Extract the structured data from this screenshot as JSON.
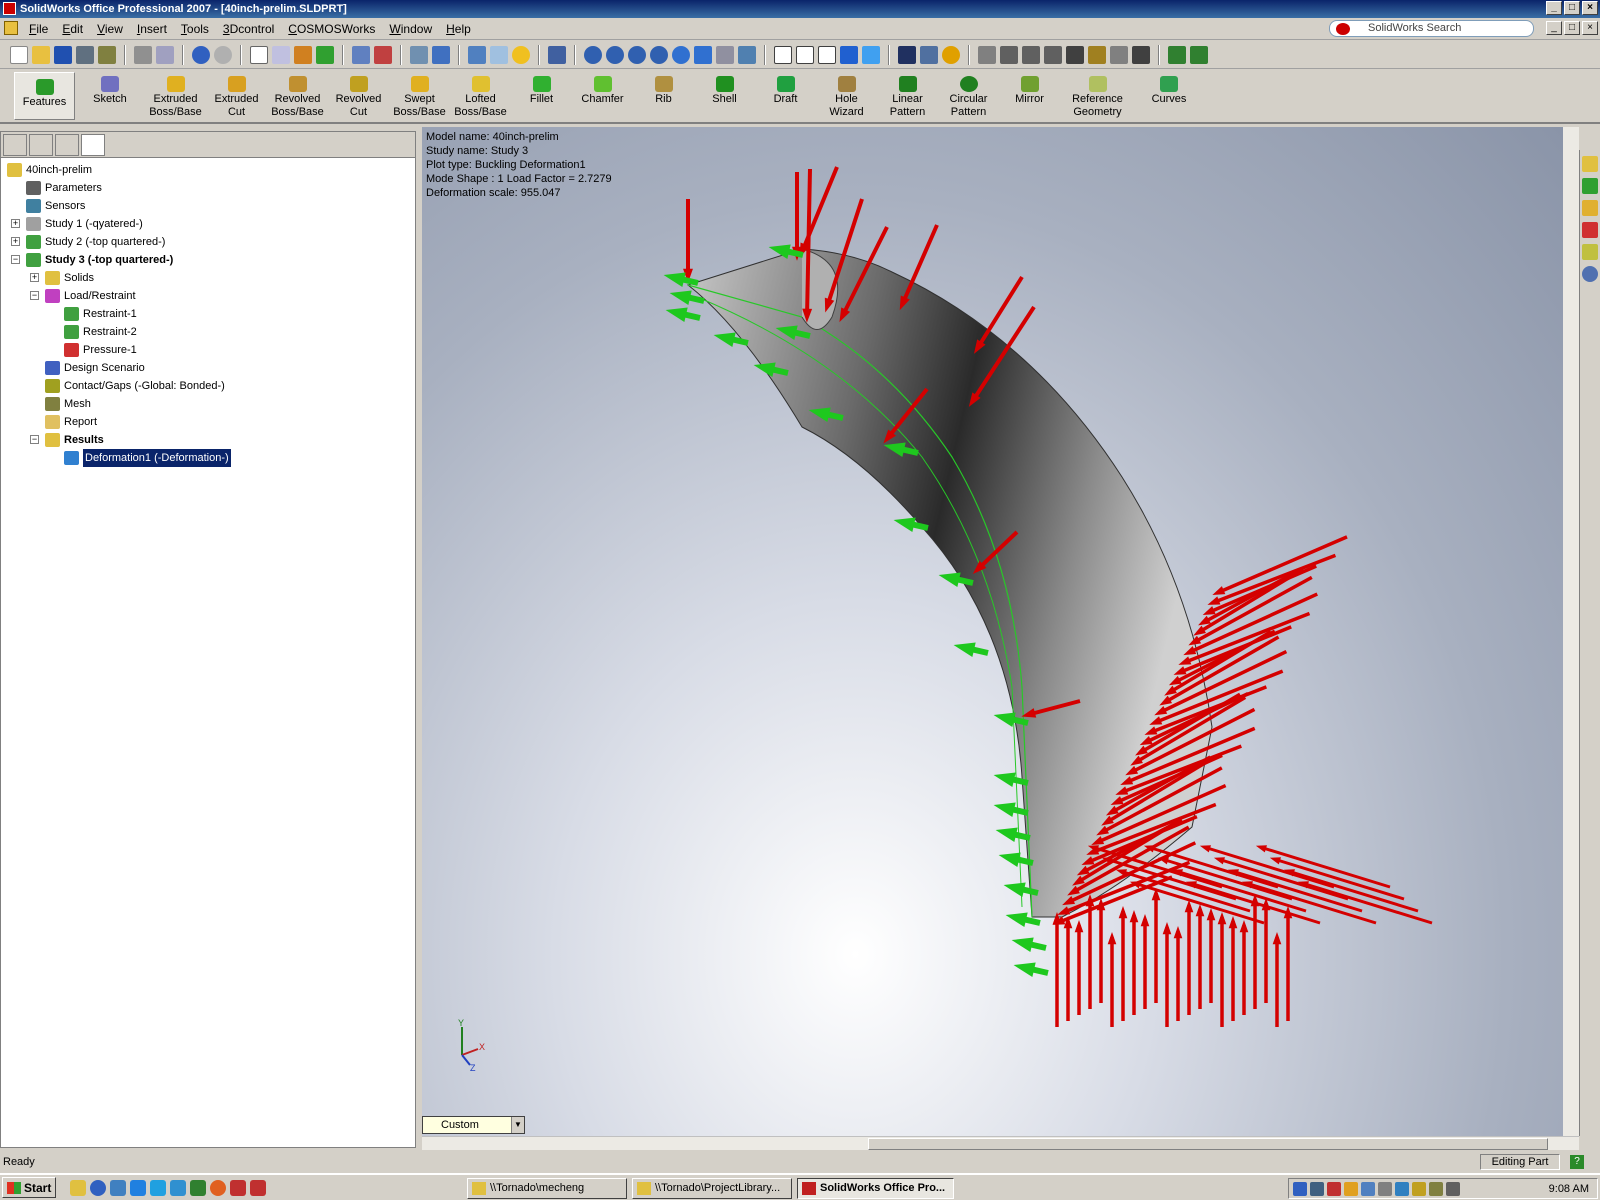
{
  "window": {
    "title": "SolidWorks Office Professional 2007 - [40inch-prelim.SLDPRT]",
    "controls": [
      "_",
      "□",
      "×"
    ]
  },
  "menu": [
    "File",
    "Edit",
    "View",
    "Insert",
    "Tools",
    "3Dcontrol",
    "COSMOSWorks",
    "Window",
    "Help"
  ],
  "search": {
    "placeholder": "SolidWorks Search"
  },
  "command_manager": [
    {
      "label": "Features",
      "icon": "features-icon"
    },
    {
      "label": "Sketch",
      "icon": "sketch-icon"
    },
    {
      "label": "Extruded\nBoss/Base",
      "icon": "extruded-boss-icon"
    },
    {
      "label": "Extruded\nCut",
      "icon": "extruded-cut-icon"
    },
    {
      "label": "Revolved\nBoss/Base",
      "icon": "revolved-boss-icon"
    },
    {
      "label": "Revolved\nCut",
      "icon": "revolved-cut-icon"
    },
    {
      "label": "Swept\nBoss/Base",
      "icon": "swept-boss-icon"
    },
    {
      "label": "Lofted\nBoss/Base",
      "icon": "lofted-boss-icon"
    },
    {
      "label": "Fillet",
      "icon": "fillet-icon"
    },
    {
      "label": "Chamfer",
      "icon": "chamfer-icon"
    },
    {
      "label": "Rib",
      "icon": "rib-icon"
    },
    {
      "label": "Shell",
      "icon": "shell-icon"
    },
    {
      "label": "Draft",
      "icon": "draft-icon"
    },
    {
      "label": "Hole\nWizard",
      "icon": "hole-wizard-icon"
    },
    {
      "label": "Linear\nPattern",
      "icon": "linear-pattern-icon"
    },
    {
      "label": "Circular\nPattern",
      "icon": "circular-pattern-icon"
    },
    {
      "label": "Mirror",
      "icon": "mirror-icon"
    },
    {
      "label": "Reference\nGeometry",
      "icon": "reference-geometry-icon"
    },
    {
      "label": "Curves",
      "icon": "curves-icon"
    }
  ],
  "tree": {
    "root": "40inch-prelim",
    "parameters": "Parameters",
    "sensors": "Sensors",
    "study1": "Study 1 (-qyatered-)",
    "study2": "Study 2 (-top quartered-)",
    "study3": "Study 3 (-top quartered-)",
    "solids": "Solids",
    "load_restraint": "Load/Restraint",
    "restraint1": "Restraint-1",
    "restraint2": "Restraint-2",
    "pressure1": "Pressure-1",
    "design_scenario": "Design Scenario",
    "contact": "Contact/Gaps (-Global: Bonded-)",
    "mesh": "Mesh",
    "report": "Report",
    "results": "Results",
    "deformation": "Deformation1 (-Deformation-)"
  },
  "plot_info": {
    "model": "Model name: 40inch-prelim",
    "study": "Study name: Study 3",
    "plot_type": "Plot type: Buckling Deformation1",
    "mode_shape": "Mode Shape : 1  Load Factor = 2.7279",
    "scale": "Deformation scale: 955.047"
  },
  "triad": {
    "x": "X",
    "y": "Y",
    "z": "Z"
  },
  "view_combo": "Custom",
  "status": {
    "left": "Ready",
    "mode": "Editing Part"
  },
  "taskbar": {
    "start": "Start",
    "tasks": [
      "\\\\Tornado\\mecheng",
      "\\\\Tornado\\ProjectLibrary...",
      "SolidWorks Office Pro..."
    ],
    "clock": "9:08 AM"
  },
  "colors": {
    "load_arrow": "#d40000",
    "restraint_arrow": "#1ec81e",
    "selection": "#0a246a",
    "title_bar": "#0a246a"
  }
}
